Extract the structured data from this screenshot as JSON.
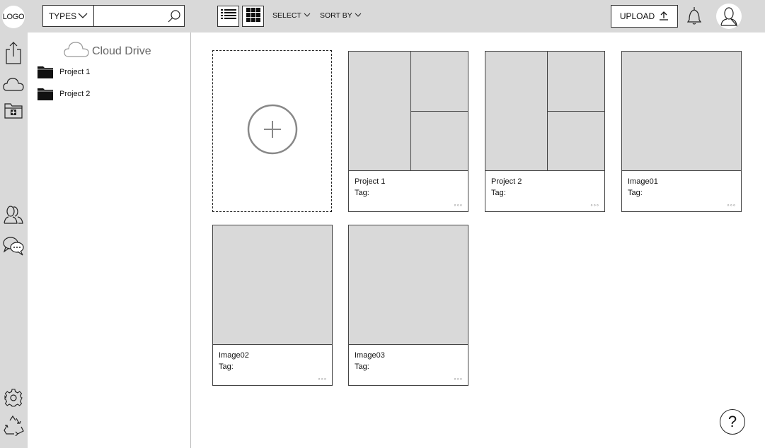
{
  "header": {
    "logo_text": "LOGO",
    "types_label": "TYPES",
    "search_placeholder": "",
    "select_label": "SELECT",
    "sortby_label": "SORT BY",
    "upload_label": "UPLOAD"
  },
  "sidebar": {
    "title": "Cloud Drive",
    "folders": [
      {
        "label": "Project 1"
      },
      {
        "label": "Project 2"
      }
    ]
  },
  "grid": {
    "items": [
      {
        "name": "Project 1",
        "tag": "Tag:",
        "more": "◦◦◦",
        "layout": "split"
      },
      {
        "name": "Project 2",
        "tag": "Tag:",
        "more": "◦◦◦",
        "layout": "split"
      },
      {
        "name": "Image01",
        "tag": "Tag:",
        "more": "◦◦◦",
        "layout": "single"
      },
      {
        "name": "Image02",
        "tag": "Tag:",
        "more": "◦◦◦",
        "layout": "single"
      },
      {
        "name": "Image03",
        "tag": "Tag:",
        "more": "◦◦◦",
        "layout": "single"
      }
    ]
  },
  "help_label": "?",
  "colors": {
    "panel_gray": "#d9d9d9",
    "border": "#444444"
  },
  "icons": [
    "search-icon",
    "list-view-icon",
    "grid-view-icon",
    "chevron-down-icon",
    "upload-arrow-icon",
    "bell-icon",
    "user-avatar-icon",
    "share-upload-icon",
    "cloud-icon",
    "new-folder-icon",
    "users-icon",
    "chat-icon",
    "gear-icon",
    "recycle-icon",
    "folder-icon",
    "plus-icon"
  ]
}
